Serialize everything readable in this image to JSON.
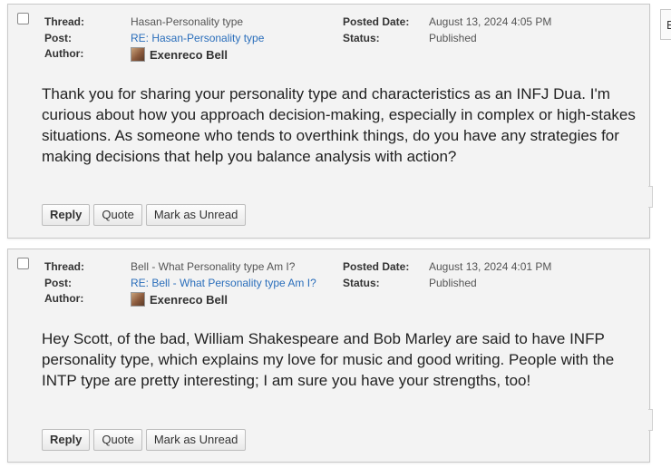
{
  "edge_tab": "E",
  "posts": [
    {
      "thread_label": "Thread:",
      "thread": "Hasan-Personality type",
      "post_label": "Post:",
      "post": "RE: Hasan-Personality type",
      "author_label": "Author:",
      "author": "Exenreco Bell",
      "posted_date_label": "Posted Date:",
      "posted_date": "August 13, 2024 4:05 PM",
      "status_label": "Status:",
      "status": "Published",
      "body": "Thank you for sharing your personality type and characteristics as an INFJ Dua. I'm curious about how you approach decision-making, especially in complex or high-stakes situations. As someone who tends to overthink things, do you have any strategies for making decisions that help you balance analysis with action?",
      "reply": "Reply",
      "quote": "Quote",
      "mark_unread": "Mark as Unread"
    },
    {
      "thread_label": "Thread:",
      "thread": "Bell - What Personality type Am I?",
      "post_label": "Post:",
      "post": "RE: Bell - What Personality type Am I?",
      "author_label": "Author:",
      "author": "Exenreco Bell",
      "posted_date_label": "Posted Date:",
      "posted_date": "August 13, 2024 4:01 PM",
      "status_label": "Status:",
      "status": "Published",
      "body": "Hey Scott, of the bad, William Shakespeare and Bob Marley are said to have INFP personality type, which explains my love for music and good writing. People with the INTP type are pretty interesting; I am sure you have your strengths, too!",
      "reply": "Reply",
      "quote": "Quote",
      "mark_unread": "Mark as Unread"
    }
  ]
}
